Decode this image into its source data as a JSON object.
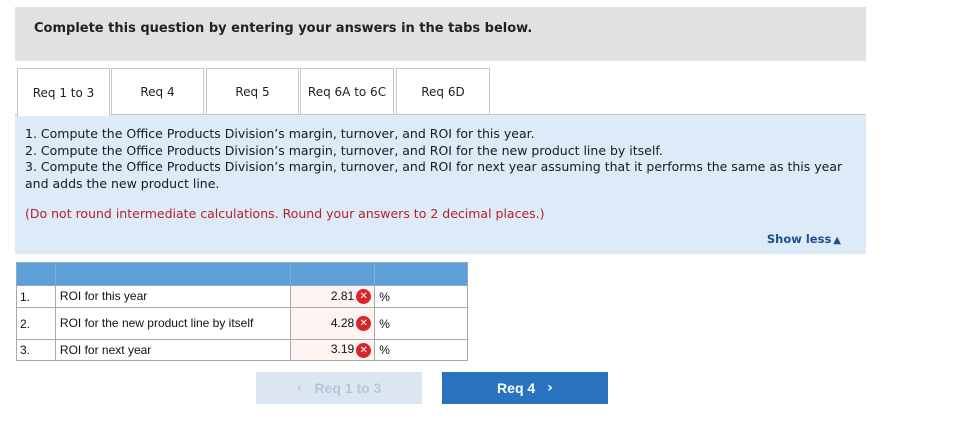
{
  "banner": {
    "text": "Complete this question by entering your answers in the tabs below."
  },
  "tabs": [
    {
      "label": "Req 1 to 3",
      "active": true
    },
    {
      "label": "Req 4",
      "active": false
    },
    {
      "label": "Req 5",
      "active": false
    },
    {
      "label": "Req 6A to 6C",
      "active": false
    },
    {
      "label": "Req 6D",
      "active": false
    }
  ],
  "instructions": {
    "line1": "1. Compute the Office Products Division’s margin, turnover, and ROI for this year.",
    "line2": "2. Compute the Office Products Division’s margin, turnover, and ROI for the new product line by itself.",
    "line3": "3. Compute the Office Products Division’s margin, turnover, and ROI for next year assuming that it performs the same as this year and adds the new product line.",
    "note": "(Do not round intermediate calculations. Round your answers to 2 decimal places.)"
  },
  "show_less": {
    "label": "Show less",
    "icon": "triangle-up-icon"
  },
  "answer_table": {
    "rows": [
      {
        "num": "1.",
        "label": "ROI for this year",
        "value": "2.81",
        "unit": "%",
        "status": "incorrect"
      },
      {
        "num": "2.",
        "label": "ROI for the new product line by itself",
        "value": "4.28",
        "unit": "%",
        "status": "incorrect"
      },
      {
        "num": "3.",
        "label": "ROI for next year",
        "value": "3.19",
        "unit": "%",
        "status": "incorrect"
      }
    ]
  },
  "nav": {
    "prev_label": "Req 1 to 3",
    "next_label": "Req 4"
  },
  "colors": {
    "banner_bg": "#e1e1e1",
    "panel_bg": "#ddeaf7",
    "note_red": "#b3232b",
    "header_blue": "#5c9fd9",
    "incorrect_red": "#d7262b",
    "next_button": "#2a73c0",
    "prev_button_disabled": "#dbe6f2"
  }
}
